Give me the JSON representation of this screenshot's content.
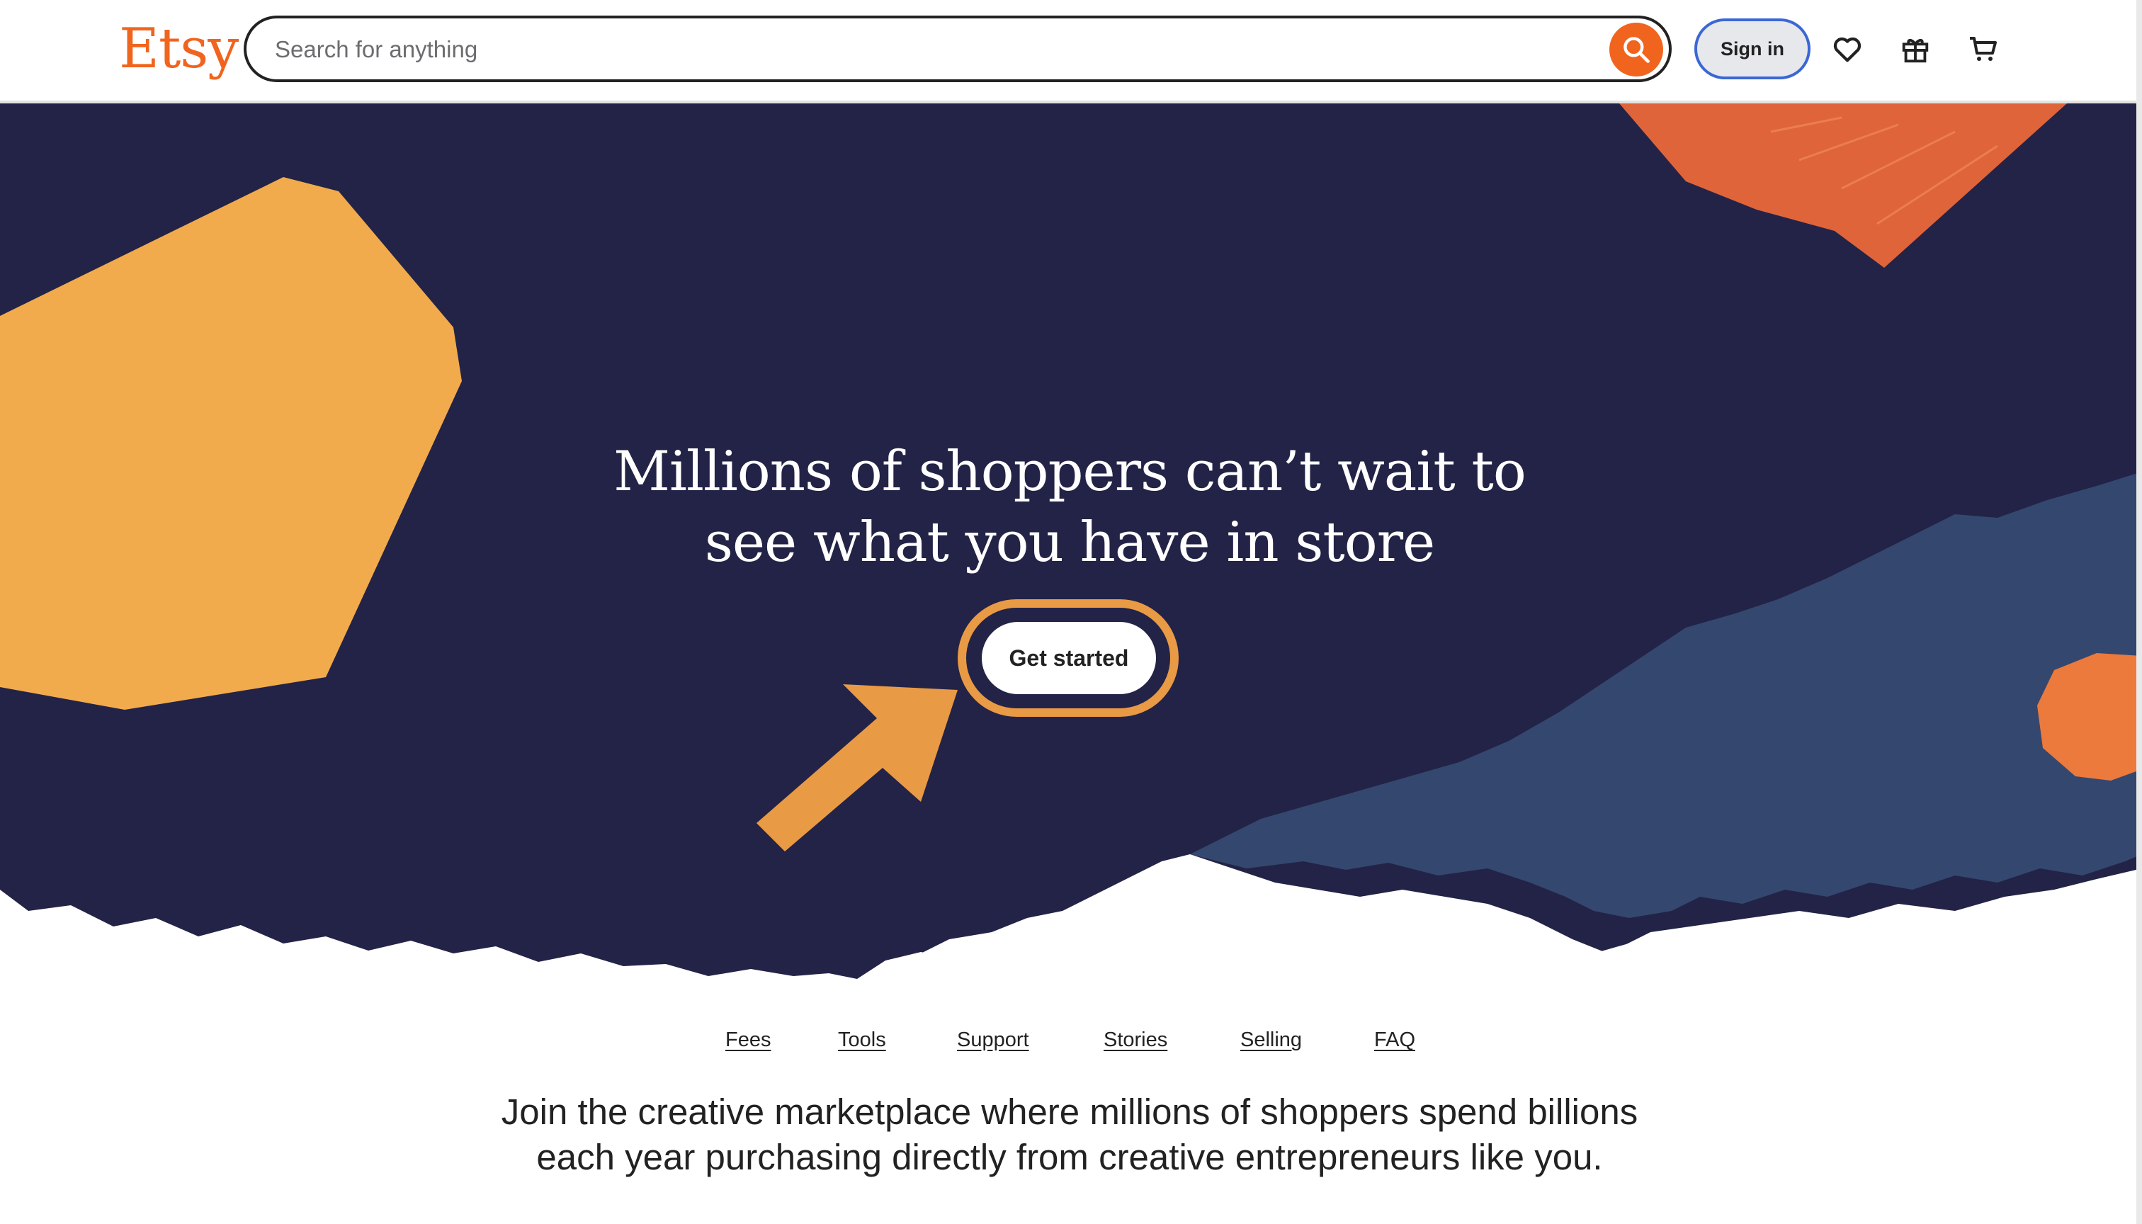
{
  "header": {
    "logo": "Etsy",
    "search_placeholder": "Search for anything",
    "sign_in_label": "Sign in",
    "icons": [
      "search-icon",
      "heart-icon",
      "gift-icon",
      "cart-icon"
    ]
  },
  "hero": {
    "headline_line1": "Millions of shoppers can’t wait to",
    "headline_line2": "see what you have in store",
    "cta_label": "Get started"
  },
  "nav": {
    "items": [
      {
        "label": "Fees"
      },
      {
        "label": "Tools"
      },
      {
        "label": "Support"
      },
      {
        "label": "Stories"
      },
      {
        "label": "Selling"
      },
      {
        "label": "FAQ"
      }
    ]
  },
  "lede": {
    "text": "Join the creative marketplace where millions of shoppers spend billions each year purchasing directly from creative entrepreneurs like you."
  },
  "colors": {
    "brand": "#f1641e",
    "hero_bg": "#232347",
    "hero_blue": "#34476f",
    "yellow": "#f2ab4c",
    "highlight": "#e99a44"
  }
}
